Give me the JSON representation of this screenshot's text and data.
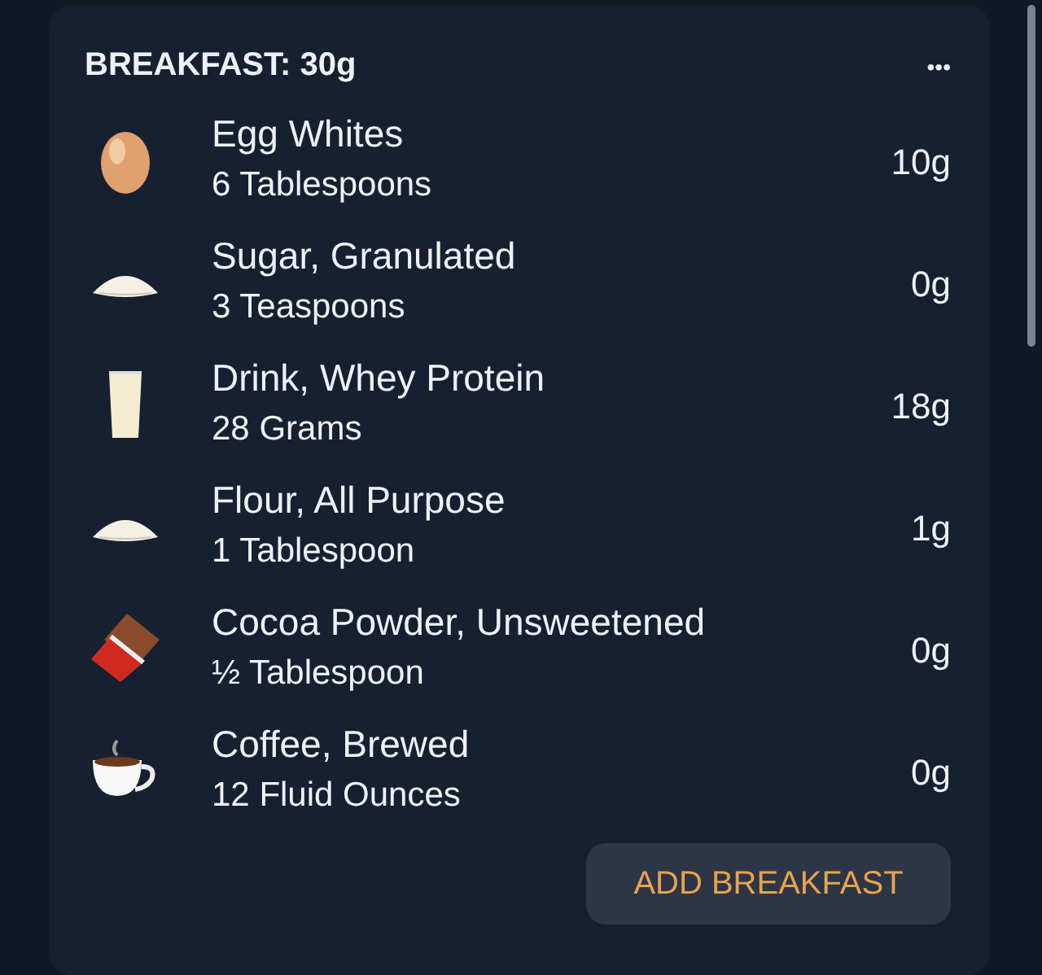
{
  "meal": {
    "title": "BREAKFAST: 30g",
    "menu_icon": "•••",
    "items": [
      {
        "kind": "egg",
        "name": "Egg Whites",
        "amount": "6 Tablespoons",
        "value": "10g"
      },
      {
        "kind": "powder",
        "name": "Sugar, Granulated",
        "amount": "3 Teaspoons",
        "value": "0g"
      },
      {
        "kind": "milk",
        "name": "Drink, Whey Protein",
        "amount": "28 Grams",
        "value": "18g"
      },
      {
        "kind": "powder",
        "name": "Flour, All Purpose",
        "amount": "1 Tablespoon",
        "value": "1g"
      },
      {
        "kind": "chocolate",
        "name": "Cocoa Powder, Unsweetened",
        "amount": "½ Tablespoon",
        "value": "0g"
      },
      {
        "kind": "coffee",
        "name": "Coffee, Brewed",
        "amount": "12 Fluid Ounces",
        "value": "0g"
      }
    ],
    "button": "ADD BREAKFAST"
  }
}
